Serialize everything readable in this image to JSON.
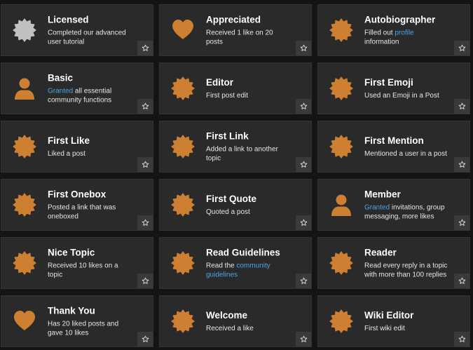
{
  "colors": {
    "page_bg": "#141414",
    "card_bg": "#2a2a2a",
    "badge_gold": "#cd7f32",
    "badge_silver": "#c0c0c0",
    "link": "#4da3e6"
  },
  "badges": [
    {
      "name": "Licensed",
      "desc": [
        {
          "t": "Completed our advanced user tutorial"
        }
      ],
      "icon": "silver-badge-icon"
    },
    {
      "name": "Appreciated",
      "desc": [
        {
          "t": "Received 1 like on 20 posts"
        }
      ],
      "icon": "heart-icon"
    },
    {
      "name": "Autobiographer",
      "desc": [
        {
          "t": "Filled out "
        },
        {
          "t": "profile",
          "link": true
        },
        {
          "t": " information"
        }
      ],
      "icon": "bronze-badge-icon"
    },
    {
      "name": "Basic",
      "desc": [
        {
          "t": "Granted",
          "link": true
        },
        {
          "t": " all essential community functions"
        }
      ],
      "icon": "user-icon"
    },
    {
      "name": "Editor",
      "desc": [
        {
          "t": "First post edit"
        }
      ],
      "icon": "bronze-badge-icon"
    },
    {
      "name": "First Emoji",
      "desc": [
        {
          "t": "Used an Emoji in a Post"
        }
      ],
      "icon": "bronze-badge-icon"
    },
    {
      "name": "First Like",
      "desc": [
        {
          "t": "Liked a post"
        }
      ],
      "icon": "bronze-badge-icon"
    },
    {
      "name": "First Link",
      "desc": [
        {
          "t": "Added a link to another topic"
        }
      ],
      "icon": "bronze-badge-icon"
    },
    {
      "name": "First Mention",
      "desc": [
        {
          "t": "Mentioned a user in a post"
        }
      ],
      "icon": "bronze-badge-icon"
    },
    {
      "name": "First Onebox",
      "desc": [
        {
          "t": "Posted a link that was oneboxed"
        }
      ],
      "icon": "bronze-badge-icon"
    },
    {
      "name": "First Quote",
      "desc": [
        {
          "t": "Quoted a post"
        }
      ],
      "icon": "bronze-badge-icon"
    },
    {
      "name": "Member",
      "desc": [
        {
          "t": "Granted",
          "link": true
        },
        {
          "t": " invitations, group messaging, more likes"
        }
      ],
      "icon": "user-icon"
    },
    {
      "name": "Nice Topic",
      "desc": [
        {
          "t": "Received 10 likes on a topic"
        }
      ],
      "icon": "bronze-badge-icon"
    },
    {
      "name": "Read Guidelines",
      "desc": [
        {
          "t": "Read the "
        },
        {
          "t": "community guidelines",
          "link": true
        }
      ],
      "icon": "bronze-badge-icon"
    },
    {
      "name": "Reader",
      "desc": [
        {
          "t": "Read every reply in a topic with more than 100 replies"
        }
      ],
      "icon": "bronze-badge-icon"
    },
    {
      "name": "Thank You",
      "desc": [
        {
          "t": "Has 20 liked posts and gave 10 likes"
        }
      ],
      "icon": "heart-icon"
    },
    {
      "name": "Welcome",
      "desc": [
        {
          "t": "Received a like"
        }
      ],
      "icon": "bronze-badge-icon"
    },
    {
      "name": "Wiki Editor",
      "desc": [
        {
          "t": "First wiki edit"
        }
      ],
      "icon": "bronze-badge-icon"
    }
  ]
}
